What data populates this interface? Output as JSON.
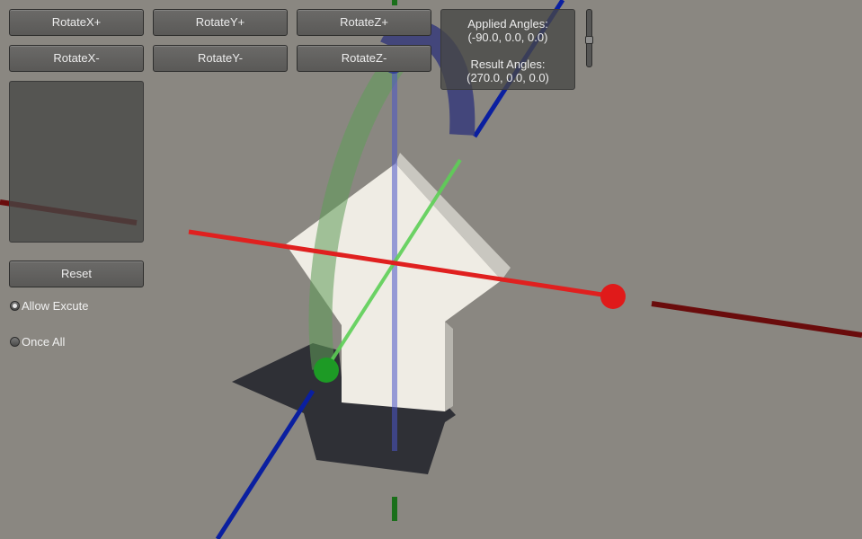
{
  "buttons": {
    "rotate_x_plus": "RotateX+",
    "rotate_y_plus": "RotateY+",
    "rotate_z_plus": "RotateZ+",
    "rotate_x_minus": "RotateX-",
    "rotate_y_minus": "RotateY-",
    "rotate_z_minus": "RotateZ-",
    "reset": "Reset"
  },
  "info": {
    "applied_label": "Applied Angles:",
    "applied_value": "(-90.0, 0.0, 0.0)",
    "result_label": "Result Angles:",
    "result_value": "(270.0, 0.0, 0.0)"
  },
  "toggles": {
    "allow_execute": {
      "label": "Allow Excute",
      "checked": true
    },
    "once_all": {
      "label": "Once All",
      "checked": false
    }
  },
  "scene": {
    "colors": {
      "x_axis": "#e0201f",
      "x_axis_dark": "#700b0b",
      "y_axis": "#1f7a1f",
      "y_axis_light": "#5ccf55",
      "z_axis": "#0a1fa0",
      "rotation_arc_green": "#6fae6a",
      "rotation_arc_blue": "#3b3f7a",
      "shadow": "#2f3036",
      "arrow_face": "#efece4",
      "arrow_side": "#c9c7c0",
      "background": "#8a8781"
    }
  }
}
